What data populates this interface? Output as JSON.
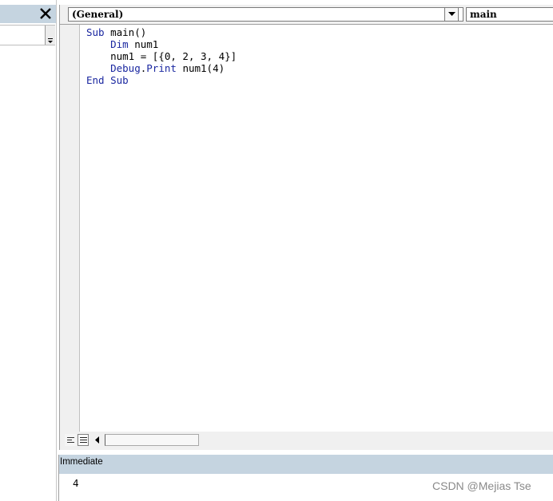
{
  "code_window": {
    "object_combo": "(General)",
    "procedure_combo": "main",
    "code_lines": [
      [
        {
          "t": "Sub",
          "k": true
        },
        {
          "t": " main()",
          "k": false
        }
      ],
      [
        {
          "t": "    ",
          "k": false
        },
        {
          "t": "Dim",
          "k": true
        },
        {
          "t": " num1",
          "k": false
        }
      ],
      [
        {
          "t": "    num1 = [{0, 2, 3, 4}]",
          "k": false
        }
      ],
      [
        {
          "t": "    ",
          "k": false
        },
        {
          "t": "Debug",
          "k": true
        },
        {
          "t": ".",
          "k": false
        },
        {
          "t": "Print",
          "k": true
        },
        {
          "t": " num1(4)",
          "k": false
        }
      ],
      [
        {
          "t": "End Sub",
          "k": true
        }
      ]
    ]
  },
  "immediate": {
    "title": "Immediate",
    "output": "4"
  },
  "watermark": "CSDN @Mejias Tse",
  "colors": {
    "keyword": "#1a27a0",
    "pane_header": "#c5d4e0"
  },
  "icons": {
    "close": "close-icon",
    "dropdown": "chevron-down-icon",
    "scroll_left": "arrow-left-icon"
  }
}
